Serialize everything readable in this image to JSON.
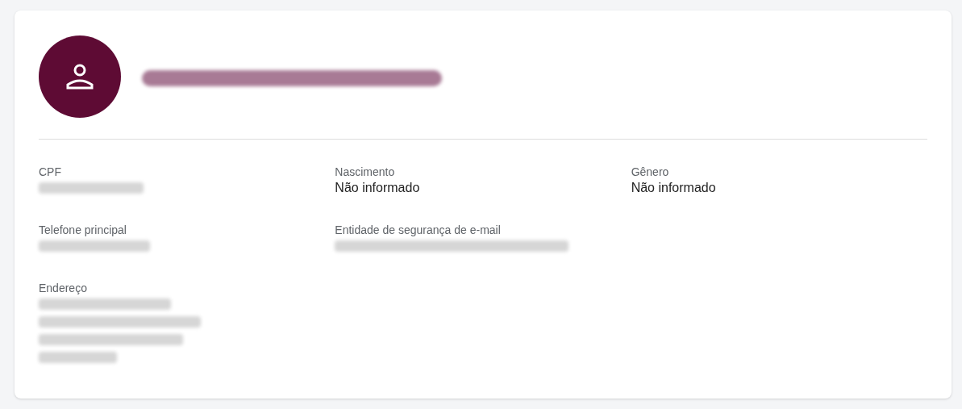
{
  "profile": {
    "name": {
      "kind": "redacted"
    }
  },
  "field_rows": [
    [
      {
        "label": "CPF",
        "value": {
          "kind": "redacted"
        }
      },
      {
        "label": "Nascimento",
        "value": {
          "kind": "text",
          "text": "Não informado"
        }
      },
      {
        "label": "Gênero",
        "value": {
          "kind": "text",
          "text": "Não informado"
        }
      }
    ],
    [
      {
        "label": "Telefone principal",
        "value": {
          "kind": "redacted"
        }
      },
      {
        "label": "Entidade de segurança de e-mail",
        "value": {
          "kind": "redacted"
        }
      }
    ],
    [
      {
        "label": "Endereço",
        "value": {
          "kind": "redacted_multiline"
        }
      }
    ]
  ]
}
